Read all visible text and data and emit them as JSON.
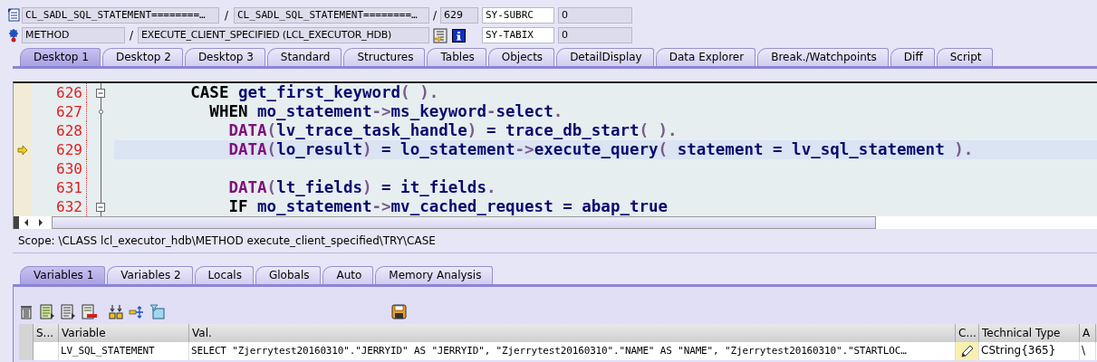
{
  "program_line": {
    "items": [
      {
        "kind": "field",
        "text": "CL_SADL_SQL_STATEMENT========…"
      },
      {
        "kind": "separator",
        "text": "/"
      },
      {
        "kind": "field",
        "text": "CL_SADL_SQL_STATEMENT========…"
      },
      {
        "kind": "separator",
        "text": "/"
      },
      {
        "kind": "field",
        "text": "629"
      }
    ],
    "system_field": {
      "name": "SY-SUBRC",
      "value": "0"
    }
  },
  "method_line": {
    "items": [
      {
        "kind": "field",
        "text": "METHOD"
      },
      {
        "kind": "separator",
        "text": "/"
      },
      {
        "kind": "field",
        "text": "EXECUTE_CLIENT_SPECIFIED (LCL_EXECUTOR_HDB)"
      },
      {
        "kind": "tools"
      }
    ],
    "system_field": {
      "name": "SY-TABIX",
      "value": "0"
    }
  },
  "desktop_tabs": [
    {
      "label": "Desktop 1",
      "selected": true
    },
    {
      "label": "Desktop 2",
      "selected": false
    },
    {
      "label": "Desktop 3",
      "selected": false
    },
    {
      "label": "Standard",
      "selected": false
    },
    {
      "label": "Structures",
      "selected": false
    },
    {
      "label": "Tables",
      "selected": false
    },
    {
      "label": "Objects",
      "selected": false
    },
    {
      "label": "DetailDisplay",
      "selected": false
    },
    {
      "label": "Data Explorer",
      "selected": false
    },
    {
      "label": "Break./Watchpoints",
      "selected": false
    },
    {
      "label": "Diff",
      "selected": false
    },
    {
      "label": "Script",
      "selected": false
    }
  ],
  "editor": {
    "lines": [
      {
        "number": "626",
        "current": false,
        "kind": "fold-start",
        "tokens": [
          {
            "kind": "keyword",
            "text": "        CASE "
          },
          {
            "kind": "ident",
            "text": "get_first_keyword"
          },
          {
            "kind": "punct",
            "text": "( )."
          }
        ]
      },
      {
        "number": "627",
        "current": false,
        "kind": "fold-branch",
        "tokens": [
          {
            "kind": "keyword",
            "text": "          WHEN "
          },
          {
            "kind": "ident",
            "text": "mo_statement"
          },
          {
            "kind": "punct",
            "text": "->"
          },
          {
            "kind": "ident",
            "text": "ms_keyword"
          },
          {
            "kind": "punct",
            "text": "-"
          },
          {
            "kind": "ident",
            "text": "select"
          },
          {
            "kind": "punct",
            "text": "."
          }
        ]
      },
      {
        "number": "628",
        "current": false,
        "kind": "plain",
        "tokens": [
          {
            "kind": "decl",
            "text": "            DATA"
          },
          {
            "kind": "punct",
            "text": "("
          },
          {
            "kind": "ident",
            "text": "lv_trace_task_handle"
          },
          {
            "kind": "punct",
            "text": ")"
          },
          {
            "kind": "ident",
            "text": " = trace_db_start"
          },
          {
            "kind": "punct",
            "text": "( )."
          }
        ]
      },
      {
        "number": "629",
        "current": true,
        "kind": "plain",
        "tokens": [
          {
            "kind": "decl",
            "text": "            DATA"
          },
          {
            "kind": "punct",
            "text": "("
          },
          {
            "kind": "ident",
            "text": "lo_result"
          },
          {
            "kind": "punct",
            "text": ")"
          },
          {
            "kind": "ident",
            "text": " = lo_statement"
          },
          {
            "kind": "punct",
            "text": "->"
          },
          {
            "kind": "ident",
            "text": "execute_query"
          },
          {
            "kind": "punct",
            "text": "( "
          },
          {
            "kind": "ident",
            "text": "statement = lv_sql_statement "
          },
          {
            "kind": "punct",
            "text": ")."
          }
        ]
      },
      {
        "number": "630",
        "current": false,
        "kind": "plain"
      },
      {
        "number": "631",
        "current": false,
        "kind": "plain",
        "tokens": [
          {
            "kind": "decl",
            "text": "            DATA"
          },
          {
            "kind": "punct",
            "text": "("
          },
          {
            "kind": "ident",
            "text": "lt_fields"
          },
          {
            "kind": "punct",
            "text": ")"
          },
          {
            "kind": "ident",
            "text": " = it_fields"
          },
          {
            "kind": "punct",
            "text": "."
          }
        ]
      },
      {
        "number": "632",
        "current": false,
        "kind": "fold-start",
        "tokens": [
          {
            "kind": "keyword",
            "text": "            IF "
          },
          {
            "kind": "ident",
            "text": "mo_statement"
          },
          {
            "kind": "punct",
            "text": "->"
          },
          {
            "kind": "ident",
            "text": "mv_cached_request = abap_true"
          }
        ]
      }
    ]
  },
  "scope": "Scope: \\CLASS lcl_executor_hdb\\METHOD execute_client_specified\\TRY\\CASE",
  "variable_tabs": [
    {
      "label": "Variables 1",
      "selected": true
    },
    {
      "label": "Variables 2",
      "selected": false
    },
    {
      "label": "Locals",
      "selected": false
    },
    {
      "label": "Globals",
      "selected": false
    },
    {
      "label": "Auto",
      "selected": false
    },
    {
      "label": "Memory Analysis",
      "selected": false
    }
  ],
  "variables_table": {
    "columns": [
      "S...",
      "Variable",
      "Val.",
      "C...",
      "Technical Type",
      "A"
    ],
    "rows": [
      {
        "variable": "LV_SQL_STATEMENT",
        "value": "SELECT \"Zjerrytest20160310\".\"JERRYID\" AS \"JERRYID\", \"Zjerrytest20160310\".\"NAME\" AS \"NAME\", \"Zjerrytest20160310\".\"STARTLOC…",
        "technical_type": "CString{365}",
        "column_6": "\\"
      }
    ]
  }
}
